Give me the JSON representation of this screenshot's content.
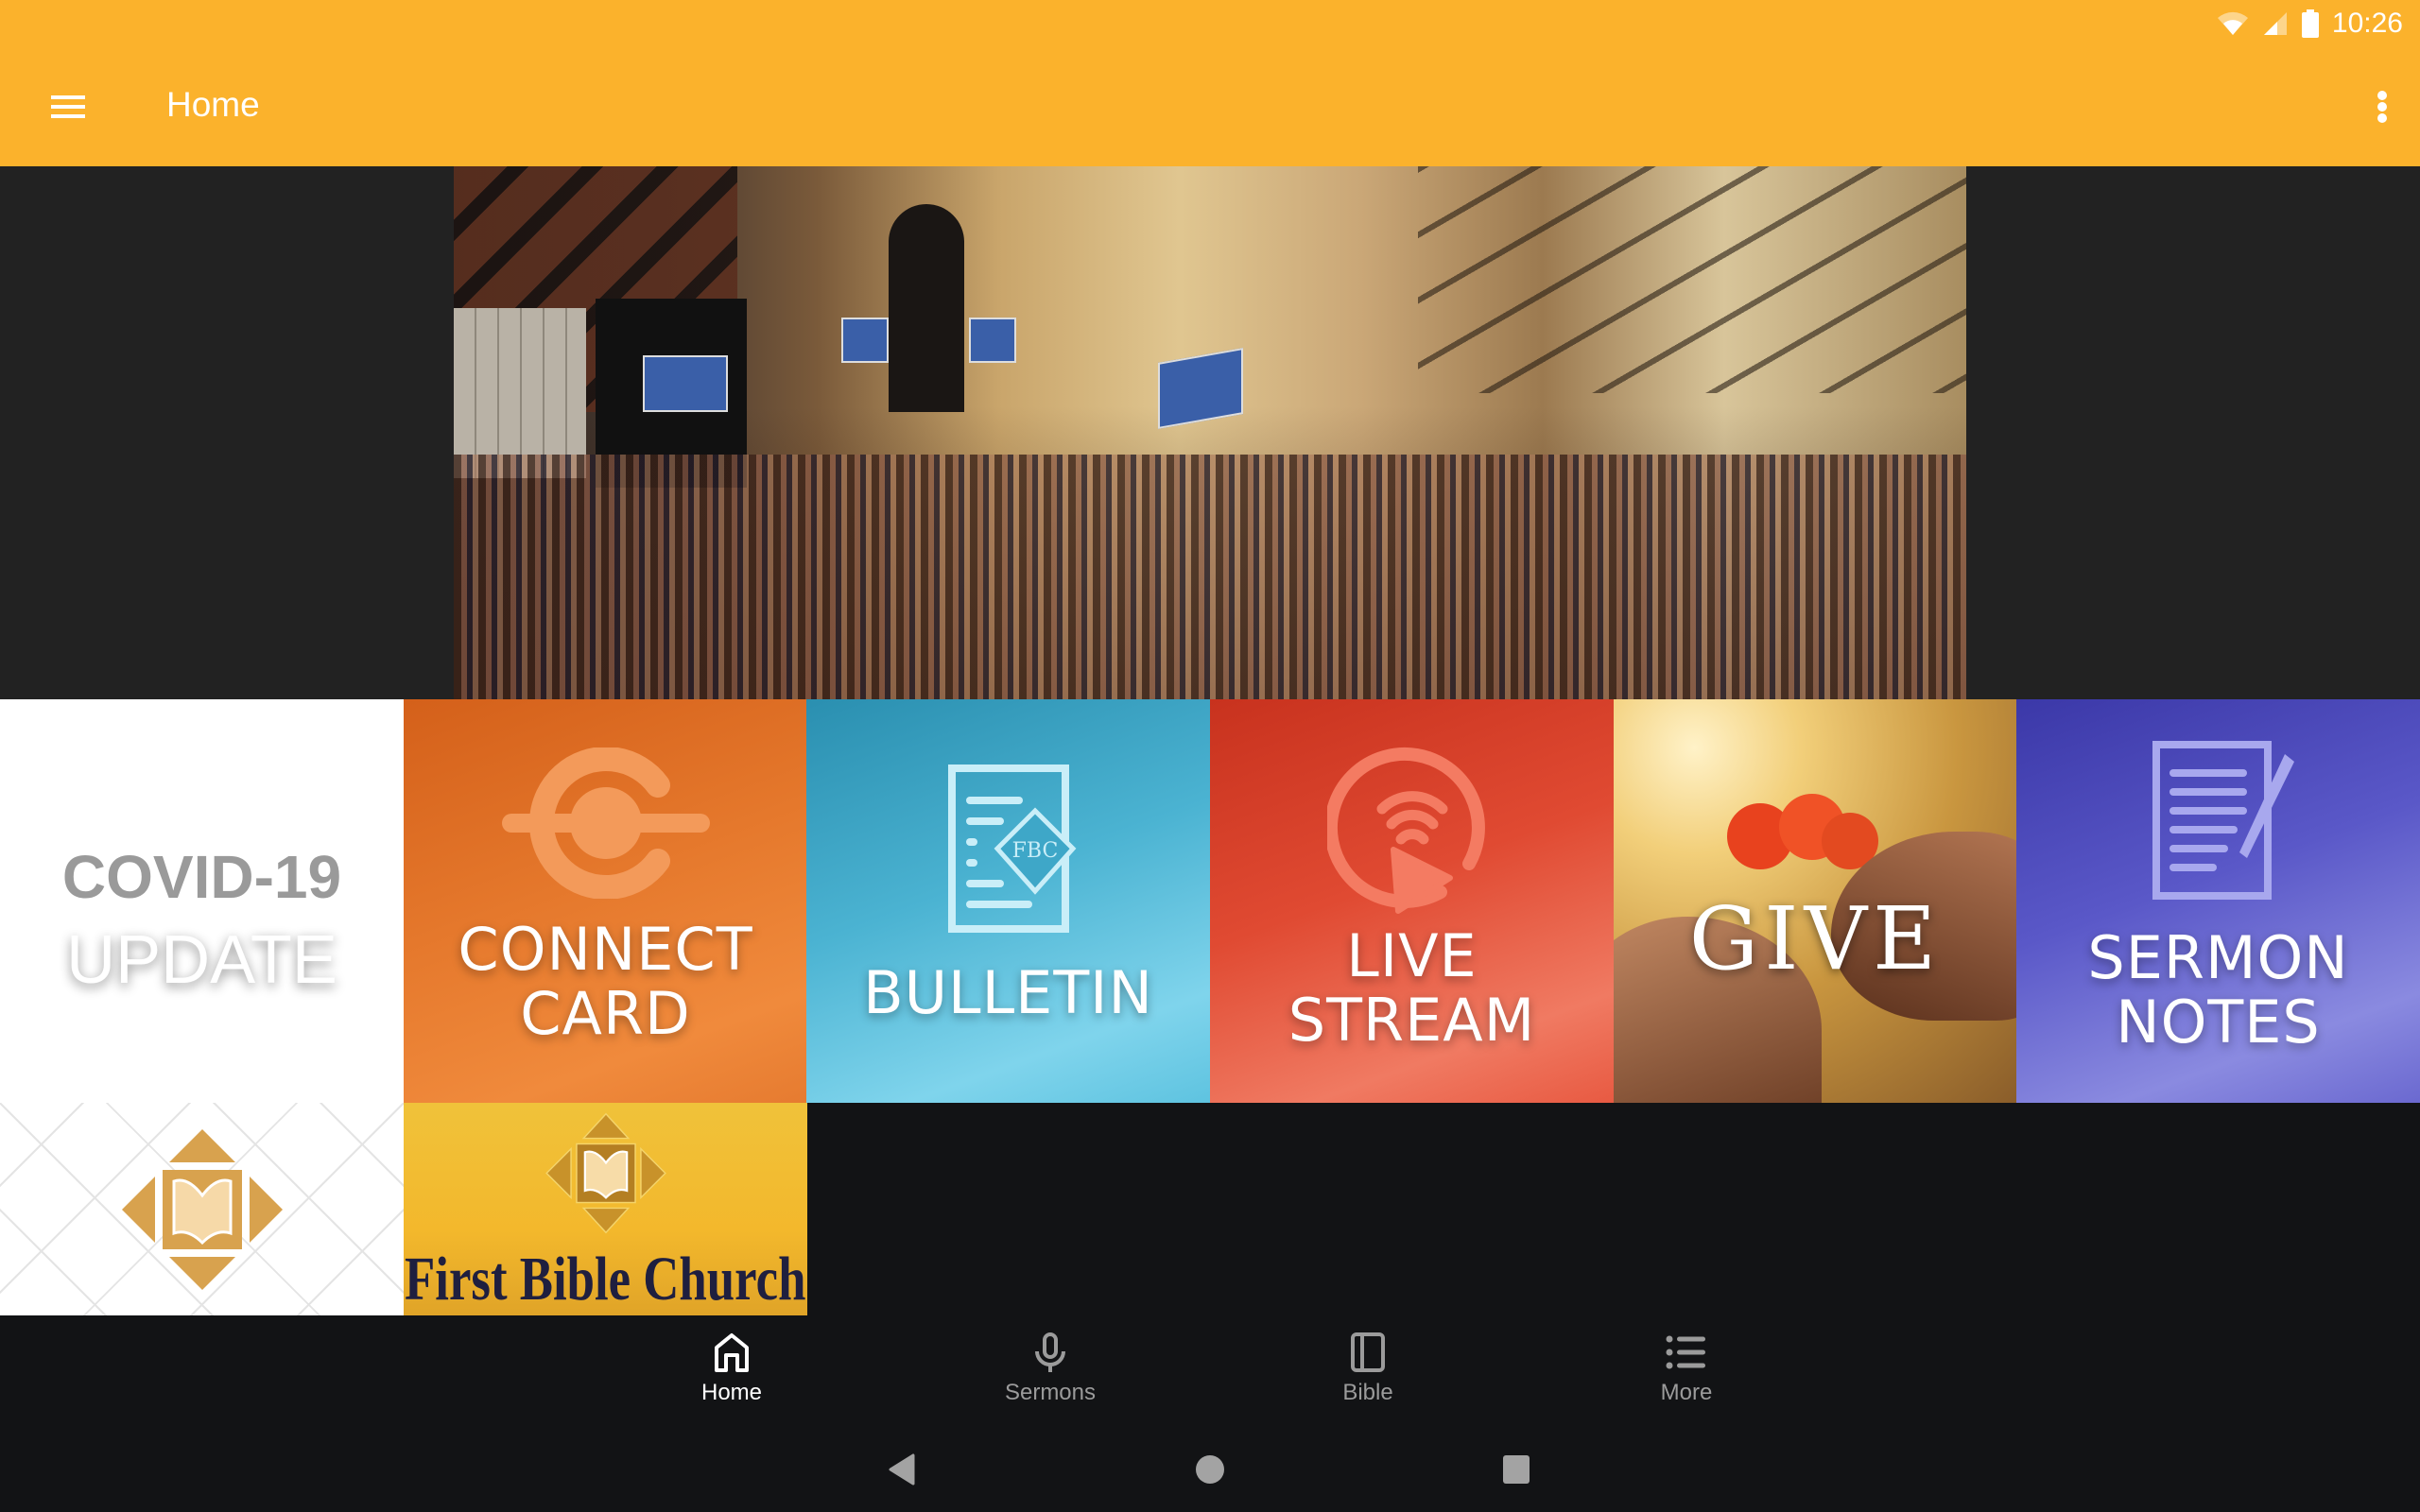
{
  "status_bar": {
    "time": "10:26",
    "icons": [
      "wifi-icon",
      "cellular-signal-icon",
      "battery-icon"
    ]
  },
  "toolbar": {
    "title": "Home",
    "menu_icon": "hamburger-menu-icon",
    "overflow_icon": "more-vert-icon",
    "background_color": "#FBB22C"
  },
  "banner": {
    "description": "Panoramic collage of church auditorium, sanctuary and gymnasium services"
  },
  "tiles": [
    {
      "id": "covid",
      "line1": "COVID-19",
      "line2": "UPDATE"
    },
    {
      "id": "connect",
      "line1": "CONNECT",
      "line2": "CARD",
      "icon": "connect-c-icon"
    },
    {
      "id": "bulletin",
      "line1": "BULLETIN",
      "icon": "bulletin-document-icon",
      "icon_text": "FBC"
    },
    {
      "id": "live",
      "line1": "LIVE",
      "line2": "STREAM",
      "icon": "live-stream-play-icon"
    },
    {
      "id": "give",
      "line1": "GIVE"
    },
    {
      "id": "sermon",
      "line1": "SERMON",
      "line2": "NOTES",
      "icon": "notes-pen-icon"
    },
    {
      "id": "logo",
      "icon": "fbc-bible-logo-icon"
    },
    {
      "id": "fbc",
      "line1": "First Bible Church",
      "icon": "fbc-bible-logo-icon"
    }
  ],
  "bottom_nav": {
    "items": [
      {
        "label": "Home",
        "icon": "home-icon",
        "active": true
      },
      {
        "label": "Sermons",
        "icon": "microphone-icon",
        "active": false
      },
      {
        "label": "Bible",
        "icon": "book-icon",
        "active": false
      },
      {
        "label": "More",
        "icon": "list-icon",
        "active": false
      }
    ]
  },
  "system_nav": {
    "buttons": [
      "back",
      "home",
      "recents"
    ]
  }
}
